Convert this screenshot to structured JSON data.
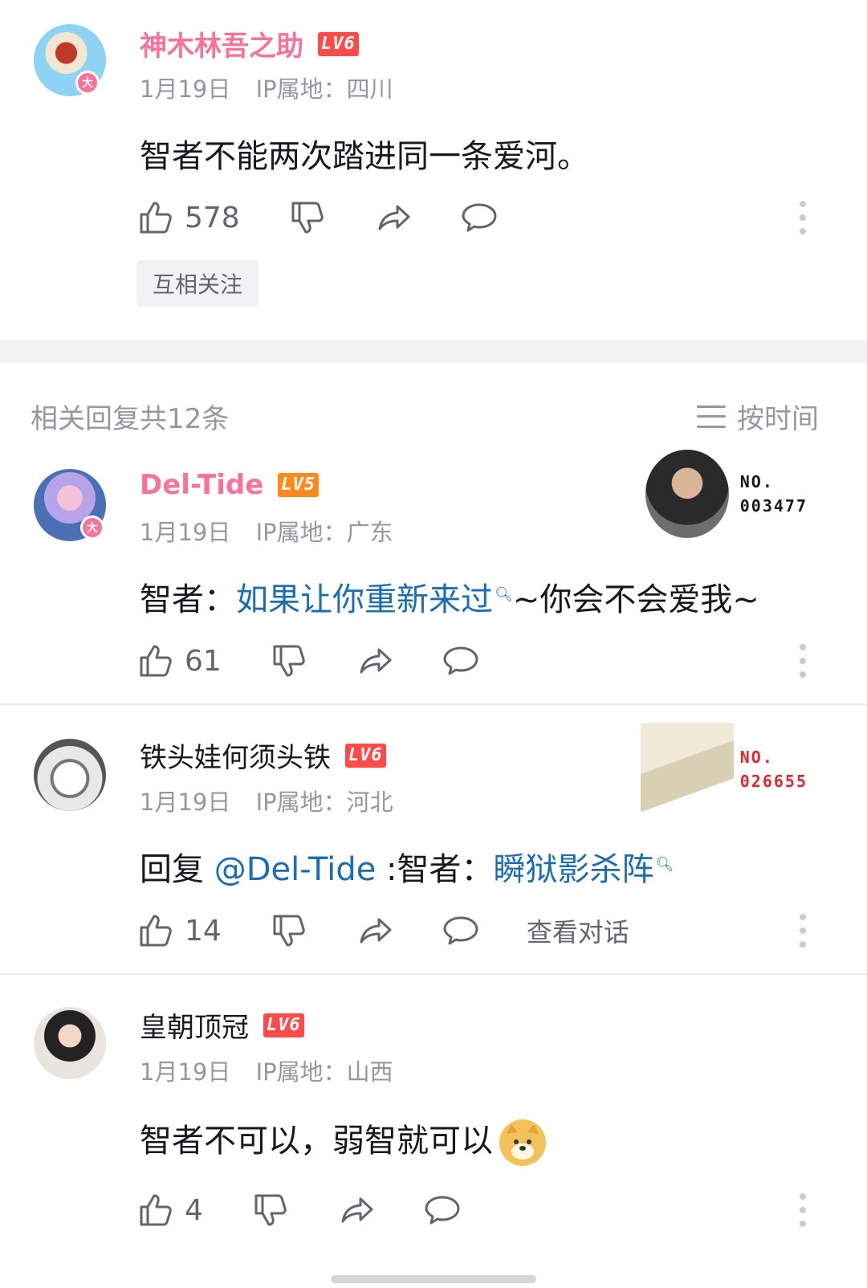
{
  "top_comment": {
    "username": "神木林吾之助",
    "level": "LV6",
    "date": "1月19日",
    "ip": "IP属地：四川",
    "content": "智者不能两次踏进同一条爱河。",
    "likes": "578",
    "tag_button": "互相关注",
    "avatar_badge": "大"
  },
  "replies_header": {
    "title": "相关回复共12条",
    "sort_label": "按时间"
  },
  "replies": [
    {
      "username": "Del-Tide",
      "level": "LV5",
      "date": "1月19日",
      "ip": "IP属地：广东",
      "content_prefix": "智者：",
      "content_link": "如果让你重新来过",
      "content_suffix": "~你会不会爱我~",
      "likes": "61",
      "avatar_badge": "大",
      "fan_card_no_label": "NO.",
      "fan_card_no_value": "003477"
    },
    {
      "username": "铁头娃何须头铁",
      "level": "LV6",
      "date": "1月19日",
      "ip": "IP属地：河北",
      "content_prefix": "回复 ",
      "content_mention": "@Del-Tide",
      "content_middle": " :智者：",
      "content_link": "瞬狱影杀阵",
      "likes": "14",
      "view_dialog": "查看对话",
      "fan_card_no_label": "NO.",
      "fan_card_no_value": "026655"
    },
    {
      "username": "皇朝顶冠",
      "level": "LV6",
      "date": "1月19日",
      "ip": "IP属地：山西",
      "content": "智者不可以，弱智就可以",
      "likes": "4"
    }
  ],
  "colors": {
    "vip_name": "#fb7299",
    "link": "#1b6db5",
    "lv6": "#ff4a4a",
    "lv5": "#ff8a1a",
    "meta_gray": "#9499a0"
  },
  "icons": {
    "like": "thumbs-up-icon",
    "dislike": "thumbs-down-icon",
    "share": "share-icon",
    "reply": "comment-bubble-icon",
    "more": "more-vertical-icon",
    "search": "search-icon"
  }
}
